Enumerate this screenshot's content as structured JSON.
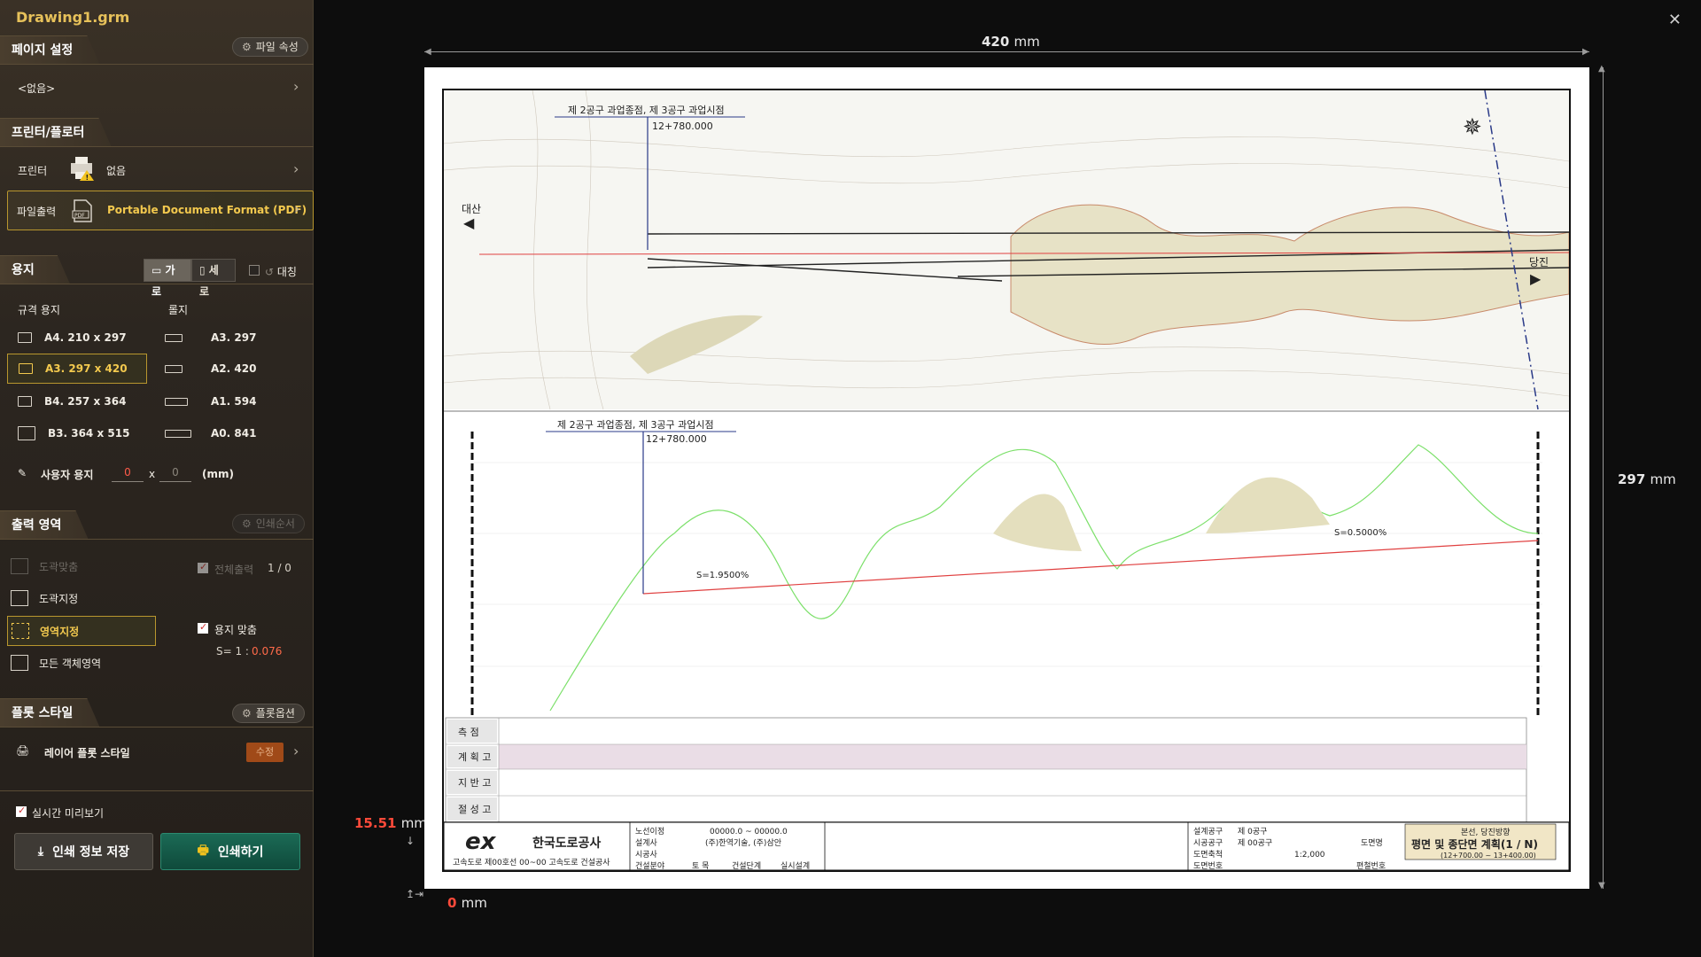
{
  "app": {
    "title": "Drawing1.grm",
    "close_icon": "close-icon"
  },
  "page_setup": {
    "title": "페이지 설정",
    "file_props_label": "파일 속성",
    "value": "<없음>"
  },
  "printer": {
    "section_title": "프린터/플로터",
    "printer_label": "프린터",
    "printer_value": "없음",
    "file_output_label": "파일출력",
    "file_output_value": "Portable Document Format (PDF)"
  },
  "paper": {
    "section_title": "용지",
    "landscape_label": "가로",
    "portrait_label": "세로",
    "mirror_label": "대칭",
    "standard_header": "규격 용지",
    "roll_header": "롤지",
    "standard_items": [
      "A4. 210 x 297",
      "A3. 297 x 420",
      "B4. 257 x 364",
      "B3. 364 x 515"
    ],
    "roll_items": [
      "A3. 297",
      "A2. 420",
      "A1. 594",
      "A0. 841"
    ],
    "selected_standard": "A3. 297 x 420",
    "custom_label": "사용자 용지",
    "custom_w": "0",
    "custom_x": "x",
    "custom_h": "0",
    "custom_unit": "(mm)"
  },
  "output_area": {
    "section_title": "출력 영역",
    "print_order_label": "인쇄순서",
    "items": [
      "도곽맞춤",
      "도곽지정",
      "영역지정",
      "모든 객체영역"
    ],
    "selected": "영역지정",
    "all_output_label": "전체출력",
    "all_output_count": "1 / 0",
    "fit_paper_label": "용지 맞춤",
    "scale_label": "S= 1 :",
    "scale_value": "0.076"
  },
  "plot_style": {
    "section_title": "플롯 스타일",
    "options_label": "플롯옵션",
    "layer_style_label": "레이어 플롯 스타일",
    "edit_label": "수정"
  },
  "realtime_preview_label": "실시간 미리보기",
  "buttons": {
    "save_label": "인쇄 정보 저장",
    "print_label": "인쇄하기"
  },
  "preview": {
    "width_value": "420",
    "height_value": "297",
    "unit": "mm",
    "offset_y": "15.51",
    "offset_x": "0"
  },
  "drawing": {
    "plan_top_label": "제 2공구 과업종점, 제 3공구 과업시점",
    "plan_station": "12+780.000",
    "left_city": "대산",
    "right_city": "당진",
    "profile_label": "제 2공구 과업종점, 제 3공구 과업시점",
    "profile_station": "12+780.000",
    "slope_left": "S=1.9500%",
    "slope_right": "S=0.5000%",
    "table_rows": [
      "측  점",
      "계 획 고",
      "지 반 고",
      "절 성 고"
    ],
    "company": "한국도로공사",
    "company_sub": "고속도로 제00호선 00~00 고속도로 건설공사",
    "title_main": "평면 및 종단면 계획(1 / N)",
    "title_sub": "본선, 당진방향",
    "title_range": "(12+700.00 ~ 13+400.00)",
    "scale": "1:2,000",
    "info_labels": [
      "노선이정",
      "설계사",
      "시공사",
      "건설분야"
    ],
    "info_values": [
      "00000.0 ~ 00000.0",
      "(주)한역기술, (주)삼안",
      "",
      "토 목"
    ],
    "stage_label": "건설단계",
    "stage_value": "실시설계",
    "right_labels": [
      "설계공구",
      "시공공구",
      "도면축척",
      "도면번호"
    ],
    "right_values": [
      "제 0공구",
      "제 00공구",
      "1:2,000",
      ""
    ],
    "drawing_name_label": "도면명",
    "edit_no_label": "편철번호"
  }
}
